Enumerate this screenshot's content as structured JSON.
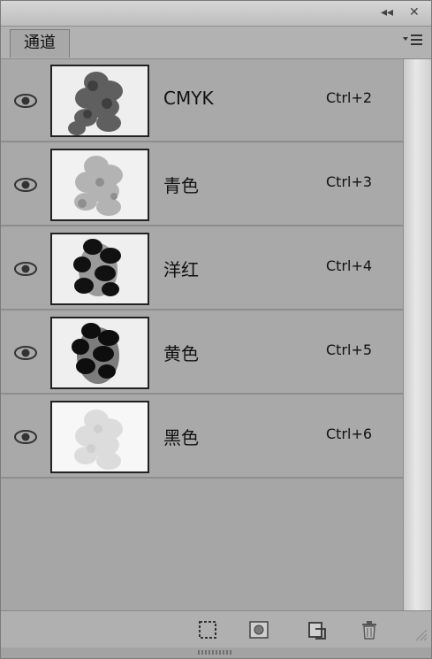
{
  "titlebar": {
    "collapse_glyph": "◂◂",
    "close_glyph": "✕"
  },
  "tabs": [
    {
      "label": "通道",
      "active": true
    }
  ],
  "panel_menu_icon": "panel-menu-icon",
  "channels": [
    {
      "name": "CMYK",
      "shortcut": "Ctrl+2",
      "visible": true,
      "thumb": "composite"
    },
    {
      "name": "青色",
      "shortcut": "Ctrl+3",
      "visible": true,
      "thumb": "light"
    },
    {
      "name": "洋红",
      "shortcut": "Ctrl+4",
      "visible": true,
      "thumb": "dark"
    },
    {
      "name": "黄色",
      "shortcut": "Ctrl+5",
      "visible": true,
      "thumb": "dark"
    },
    {
      "name": "黑色",
      "shortcut": "Ctrl+6",
      "visible": true,
      "thumb": "faint"
    }
  ],
  "toolbar": [
    {
      "icon": "load-selection-icon"
    },
    {
      "icon": "save-selection-icon"
    },
    {
      "icon": "new-channel-icon"
    },
    {
      "icon": "delete-channel-icon"
    }
  ],
  "colors": {
    "panel_bg": "#a9a9a9",
    "row_border": "#8e8e8e",
    "text": "#111111"
  }
}
